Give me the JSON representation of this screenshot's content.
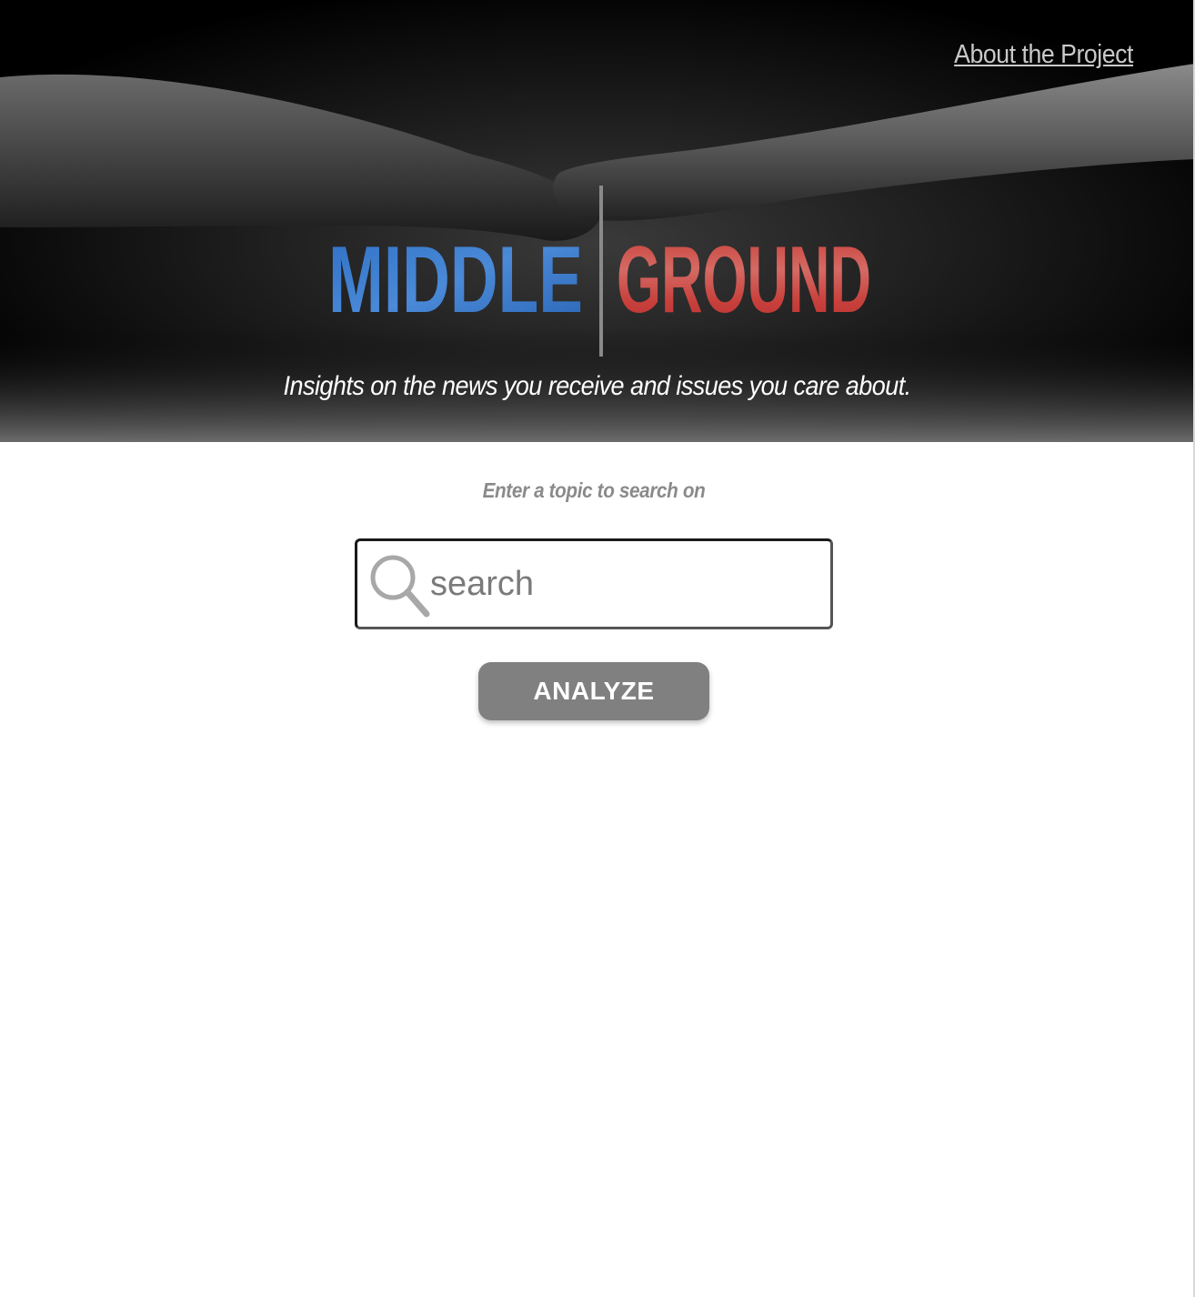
{
  "nav": {
    "about_label": "About the Project"
  },
  "hero": {
    "logo_left": "MIDDLE",
    "logo_right": "GROUND",
    "tagline": "Insights on the news you receive and issues you care about."
  },
  "search": {
    "prompt": "Enter a topic to search on",
    "placeholder": "search",
    "value": "",
    "icon": "search-icon"
  },
  "actions": {
    "analyze_label": "ANALYZE"
  },
  "colors": {
    "hero_background": "#000000",
    "logo_blue": "#3a78c8",
    "logo_red": "#c8403c",
    "button": "#808080",
    "prompt_text": "#8a8a8a"
  }
}
